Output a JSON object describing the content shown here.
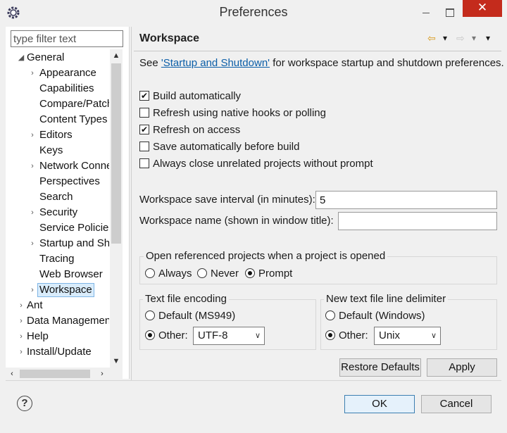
{
  "window": {
    "title": "Preferences",
    "close_glyph": "✕"
  },
  "filter": {
    "placeholder": "type filter text",
    "value": ""
  },
  "tree": {
    "items": [
      {
        "label": "General",
        "twisty": "◢"
      },
      {
        "label": "Appearance",
        "twisty": "›"
      },
      {
        "label": "Capabilities",
        "twisty": ""
      },
      {
        "label": "Compare/Patch",
        "twisty": ""
      },
      {
        "label": "Content Types",
        "twisty": ""
      },
      {
        "label": "Editors",
        "twisty": "›"
      },
      {
        "label": "Keys",
        "twisty": ""
      },
      {
        "label": "Network Connections",
        "twisty": "›"
      },
      {
        "label": "Perspectives",
        "twisty": ""
      },
      {
        "label": "Search",
        "twisty": ""
      },
      {
        "label": "Security",
        "twisty": "›"
      },
      {
        "label": "Service Policies",
        "twisty": ""
      },
      {
        "label": "Startup and Shutdown",
        "twisty": "›"
      },
      {
        "label": "Tracing",
        "twisty": ""
      },
      {
        "label": "Web Browser",
        "twisty": ""
      },
      {
        "label": "Workspace",
        "twisty": "›"
      },
      {
        "label": "Ant",
        "twisty": "›"
      },
      {
        "label": "Data Management",
        "twisty": "›"
      },
      {
        "label": "Help",
        "twisty": "›"
      },
      {
        "label": "Install/Update",
        "twisty": "›"
      }
    ],
    "selected": "Workspace"
  },
  "scroll": {
    "up": "▲",
    "down": "▼",
    "left": "‹",
    "right": "›"
  },
  "page": {
    "title": "Workspace",
    "nav": {
      "back": "⇦",
      "back_menu": "▾",
      "forward": "⇨",
      "forward_menu": "▾",
      "view_menu": "▾"
    },
    "intro_prefix": "See ",
    "intro_link": "'Startup and Shutdown'",
    "intro_suffix": " for workspace startup and shutdown preferences.",
    "checkboxes": [
      {
        "label": "Build automatically",
        "checked": true
      },
      {
        "label": "Refresh using native hooks or polling",
        "checked": false
      },
      {
        "label": "Refresh on access",
        "checked": true
      },
      {
        "label": "Save automatically before build",
        "checked": false
      },
      {
        "label": "Always close unrelated projects without prompt",
        "checked": false
      }
    ],
    "save_interval_label": "Workspace save interval (in minutes):",
    "save_interval_value": "5",
    "workspace_name_label": "Workspace name (shown in window title):",
    "workspace_name_value": "",
    "open_ref": {
      "title": "Open referenced projects when a project is opened",
      "options": [
        "Always",
        "Never",
        "Prompt"
      ],
      "selected": "Prompt"
    },
    "encoding": {
      "title": "Text file encoding",
      "default_label": "Default (MS949)",
      "other_label": "Other:",
      "value": "UTF-8",
      "selected": "Other"
    },
    "delimiter": {
      "title": "New text file line delimiter",
      "default_label": "Default (Windows)",
      "other_label": "Other:",
      "value": "Unix",
      "selected": "Other"
    },
    "restore_defaults": "Restore Defaults",
    "apply": "Apply"
  },
  "footer": {
    "help": "?",
    "ok": "OK",
    "cancel": "Cancel"
  }
}
